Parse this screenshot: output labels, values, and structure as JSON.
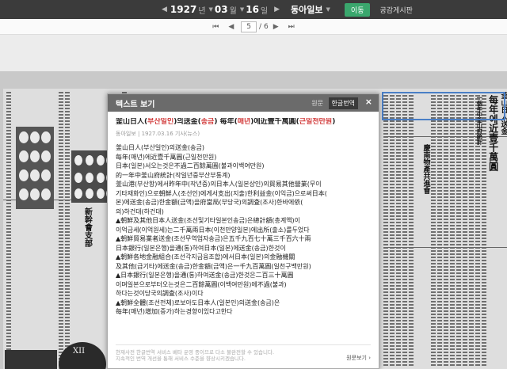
{
  "topbar": {
    "year": "1927",
    "year_unit": "년",
    "month": "03",
    "month_unit": "월",
    "day": "16",
    "day_unit": "일",
    "newspaper": "동아일보",
    "move_label": "이동",
    "list_link": "공감게시판"
  },
  "pagebar": {
    "current_page": "5",
    "total_pages": "6",
    "separator": "/"
  },
  "text_view": {
    "title": "텍스트 보기",
    "tab_original": "원문",
    "tab_korean": "한글번역",
    "close_symbol": "×",
    "article_title_prefix": "釜山日人(",
    "article_title_red1": "부산일인",
    "article_title_mid1": ")의送金(",
    "article_title_red2": "송금",
    "article_title_mid2": ") 每年(",
    "article_title_red3": "매년",
    "article_title_mid3": ")에近壹千萬圓(",
    "article_title_red4": "근일천만원",
    "article_title_suffix": ")",
    "meta": "동아일보 | 1927.03.16 기사(뉴스)",
    "lines": [
      "釜山日人(부산일인)의送金(송금)",
      "每年(매년)에近壹千萬圓(근일천만원)",
      "日本(일본)서오는것은不過二百餘萬圓(불과이백여만원)",
      "的一年中釜山府統計(작일년중부산부통계)",
      "釜山港(부산항)에서昨年中(작년중)의日本人(일본상인)의貿易其他營業(무이",
      "기타재화인)으로朝鮮人(조선인)에게서支出(지출)한利益金(이익금)으로써日本(",
      "본)에送金(송금)한金額(금액)을府當局(부당국)의調査(조사)한바에依(",
      "의)하건대(하건대)",
      "▲朝鮮及其他日本人送金(조선및기타일본인송금)은總計額(총계액)이",
      "이억금세(이억원세)는二千萬兩日本(이천만양일본)에出所(출소)를두었다",
      "▲朝鮮貿易業者送金(조선무역업자송금)은五千九百七十萬三千百六十兩",
      "日本銀行(일본은행)을通(통)하여日本(일본)에送金(송금)한것이",
      "▲朝鮮各地金融組合(조선각지금융조합)에서日本(일본)의金融機關",
      "及其他(급기타)에送金(송금)한金額(금액)은一千九百萬圓(일천구백만원)",
      "▲日本銀行(일본은행)을通(통)하여送金(송금)한것은二百三十萬圓",
      "이며일본으로부터오는것은二百餘萬圓(이백여만원)에不過(불과)",
      "하다는것이당국의調査(조사)이다",
      "▲朝鮮全體(조선전체)로보아도日本人(일본인)의送金(송금)은",
      "每年(매년)增加(증가)하는경향이있다고한다"
    ],
    "footer_line1": "현재사전 한글번역 서비스 베타 운영 중이므로 다소 불완전할 수 있습니다.",
    "footer_line2": "지속적인 번역 개선을 통해 서비스 수준을 향상시키겠습니다.",
    "footer_link": "원문보기 ›"
  },
  "newspaper_scan": {
    "headline_right_1": "釜山日人送金",
    "headline_right_2": "每年에近壹千萬圓",
    "headline_right_3": "一個年中釜山府統計",
    "headline_mid": "慶南物產共進會",
    "headline_left": "新幹會支部",
    "clock_label": "XII"
  }
}
